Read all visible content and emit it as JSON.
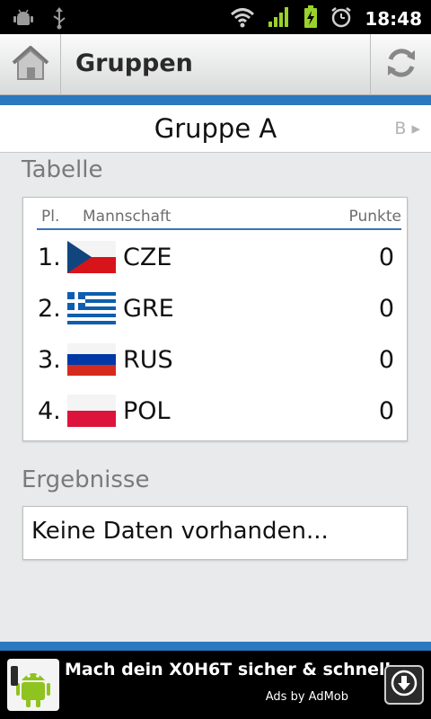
{
  "status_bar": {
    "time": "18:48",
    "left_icons": [
      "android-debug-icon",
      "usb-icon"
    ],
    "right_icons": [
      "wifi-icon",
      "signal-icon",
      "battery-charging-icon",
      "alarm-icon"
    ]
  },
  "action_bar": {
    "title": "Gruppen",
    "home_icon": "home-icon",
    "refresh_icon": "refresh-icon"
  },
  "group_selector": {
    "current": "Gruppe A",
    "next_label": "B ▸"
  },
  "table_section": {
    "heading": "Tabelle",
    "headers": {
      "place": "Pl.",
      "team": "Mannschaft",
      "points": "Punkte"
    },
    "rows": [
      {
        "place": "1.",
        "team": "CZE",
        "points": "0",
        "flag": "czech-flag"
      },
      {
        "place": "2.",
        "team": "GRE",
        "points": "0",
        "flag": "greek-flag"
      },
      {
        "place": "3.",
        "team": "RUS",
        "points": "0",
        "flag": "russian-flag"
      },
      {
        "place": "4.",
        "team": "POL",
        "points": "0",
        "flag": "polish-flag"
      }
    ]
  },
  "results_section": {
    "heading": "Ergebnisse",
    "empty_text": "Keine Daten vorhanden..."
  },
  "ad": {
    "text": "Mach dein X0H6T sicher & schnell.",
    "attribution": "Ads by AdMob",
    "icon": "android-robot-icon",
    "action_icon": "download-icon"
  },
  "colors": {
    "accent_blue": "#2a78bf",
    "background": "#e9eaeb"
  }
}
